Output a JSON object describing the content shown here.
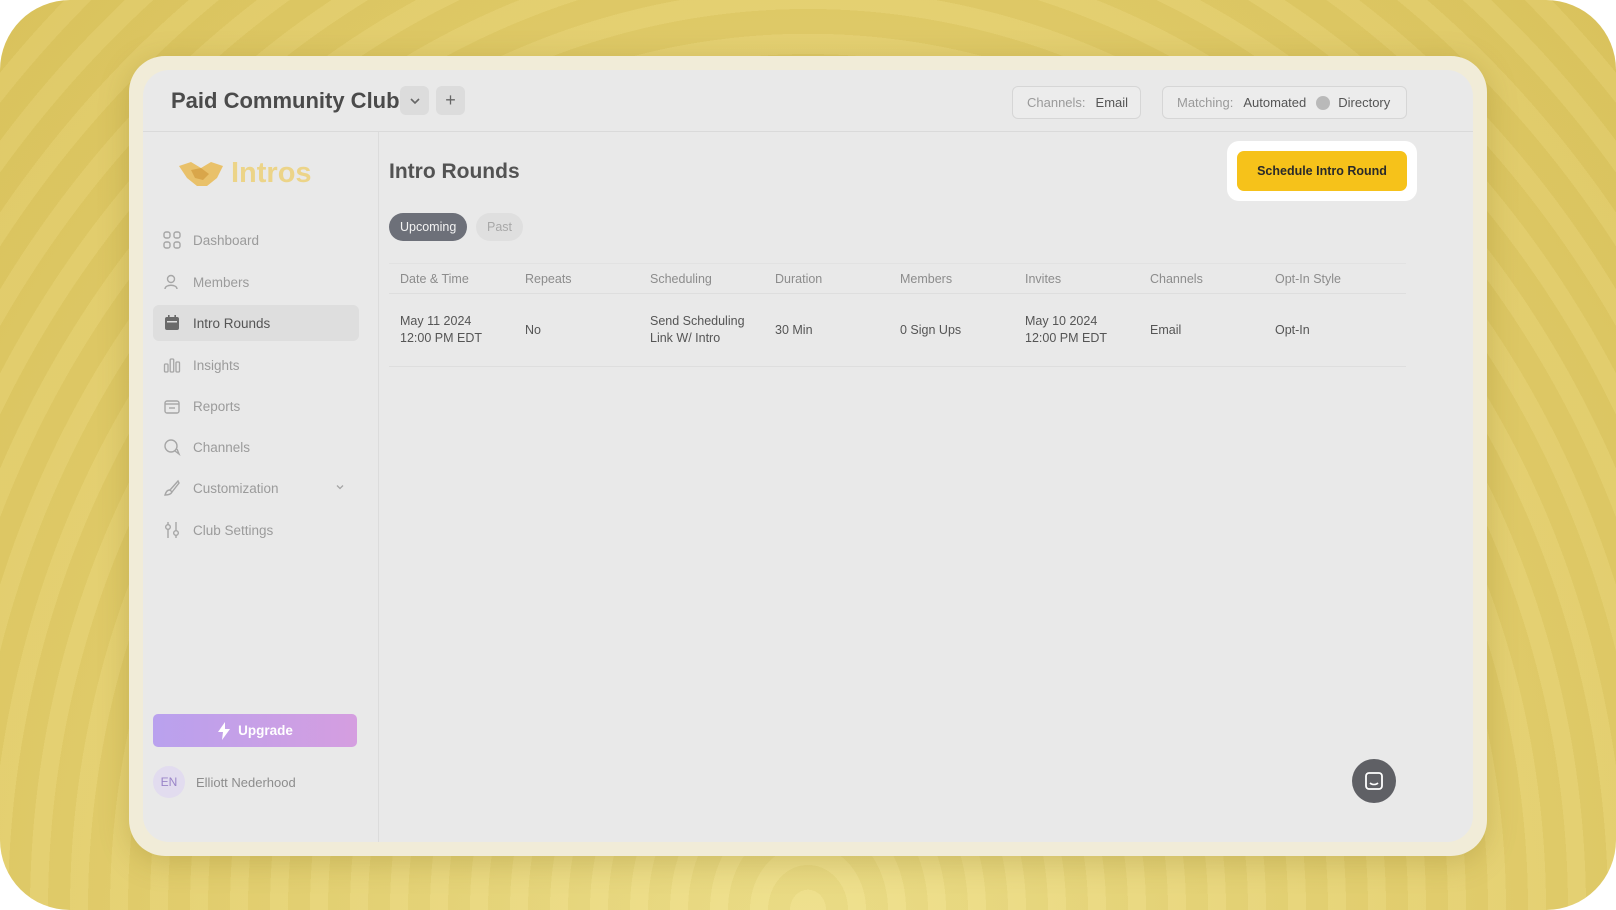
{
  "header": {
    "club_title": "Paid Community Club",
    "dropdown_glyph": "⌄",
    "add_glyph": "+",
    "channels_label": "Channels:",
    "channels_value": "Email",
    "matching_label": "Matching:",
    "matching_value": "Automated",
    "matching_alt": "Directory"
  },
  "sidebar": {
    "logo_text": "Intros",
    "items": [
      {
        "label": "Dashboard",
        "icon": "grid-icon"
      },
      {
        "label": "Members",
        "icon": "users-icon"
      },
      {
        "label": "Intro Rounds",
        "icon": "calendar-icon"
      },
      {
        "label": "Insights",
        "icon": "bar-chart-icon"
      },
      {
        "label": "Reports",
        "icon": "report-icon"
      },
      {
        "label": "Channels",
        "icon": "chat-bubbles-icon"
      },
      {
        "label": "Customization",
        "icon": "brush-icon"
      },
      {
        "label": "Club Settings",
        "icon": "sliders-icon"
      }
    ],
    "upgrade_label": "Upgrade",
    "user_initials": "EN",
    "user_name": "Elliott Nederhood"
  },
  "main": {
    "title": "Intro Rounds",
    "cta_label": "Schedule Intro Round",
    "tabs": [
      "Upcoming",
      "Past"
    ],
    "columns": [
      "Date & Time",
      "Repeats",
      "Scheduling",
      "Duration",
      "Members",
      "Invites",
      "Channels",
      "Opt-In Style"
    ],
    "rows": [
      {
        "date_line1": "May 11 2024",
        "date_line2": "12:00 PM EDT",
        "repeats": "No",
        "scheduling_line1": "Send Scheduling",
        "scheduling_line2": "Link W/ Intro",
        "duration": "30 Min",
        "members": "0 Sign Ups",
        "invites_line1": "May 10 2024",
        "invites_line2": "12:00 PM EDT",
        "channels": "Email",
        "optin": "Opt-In"
      }
    ]
  },
  "colors": {
    "accent": "#f6c21a",
    "upgrade_start": "#b9a1ee",
    "upgrade_end": "#d59ee0",
    "background": "#e4cf6c"
  }
}
